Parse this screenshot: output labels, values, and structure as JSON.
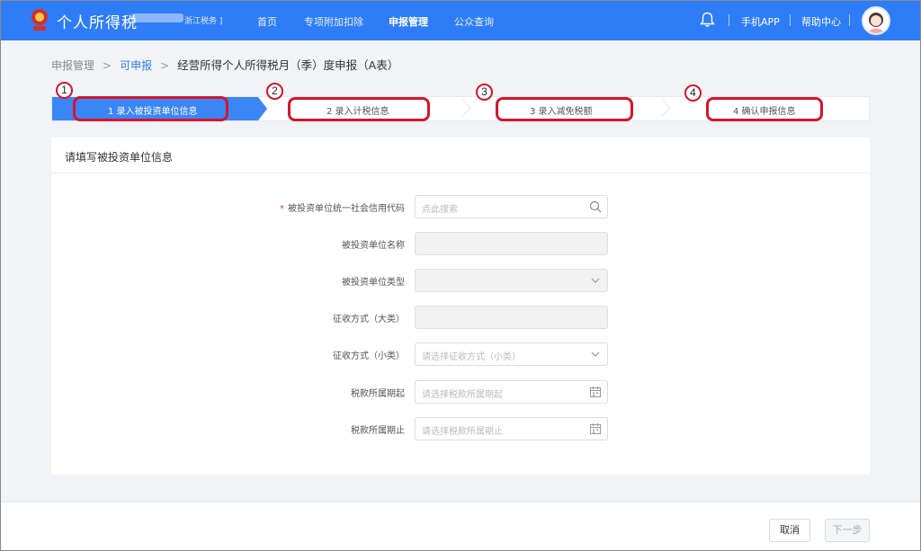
{
  "topbar": {
    "app_title": "个人所得税",
    "region_suffix": "浙江税务 ]",
    "nav": [
      "首页",
      "专项附加扣除",
      "申报管理",
      "公众查询"
    ],
    "active_nav": "申报管理",
    "mobile_app": "手机APP",
    "help_center": "帮助中心",
    "accent_color": "#2f7df6"
  },
  "breadcrumb": {
    "items": [
      "申报管理",
      "可申报",
      "经营所得个人所得税月（季）度申报（A表）"
    ],
    "separator": ">"
  },
  "steps": {
    "items": [
      "1 录入被投资单位信息",
      "2 录入计税信息",
      "3 录入减免税额",
      "4 确认申报信息"
    ],
    "active_index": 0,
    "annotation_numbers": [
      "1",
      "2",
      "3",
      "4"
    ],
    "annotation_color": "#d9132a"
  },
  "form": {
    "section_title": "请填写被投资单位信息",
    "fields": [
      {
        "label": "被投资单位统一社会信用代码",
        "required": true,
        "placeholder": "点此搜索",
        "icon": "search-icon"
      },
      {
        "label": "被投资单位名称",
        "required": false,
        "placeholder": "",
        "disabled": true
      },
      {
        "label": "被投资单位类型",
        "required": false,
        "placeholder": "",
        "disabled": true,
        "icon": "chevron-down-icon"
      },
      {
        "label": "征收方式（大类）",
        "required": false,
        "placeholder": "",
        "disabled": true
      },
      {
        "label": "征收方式（小类）",
        "required": false,
        "placeholder": "请选择征收方式（小类）",
        "icon": "chevron-down-icon"
      },
      {
        "label": "税款所属期起",
        "required": false,
        "placeholder": "请选择税款所属期起",
        "icon": "calendar-icon"
      },
      {
        "label": "税款所属期止",
        "required": false,
        "placeholder": "请选择税款所属期止",
        "icon": "calendar-icon"
      }
    ]
  },
  "footer": {
    "cancel_label": "取消",
    "next_label": "下一步"
  }
}
